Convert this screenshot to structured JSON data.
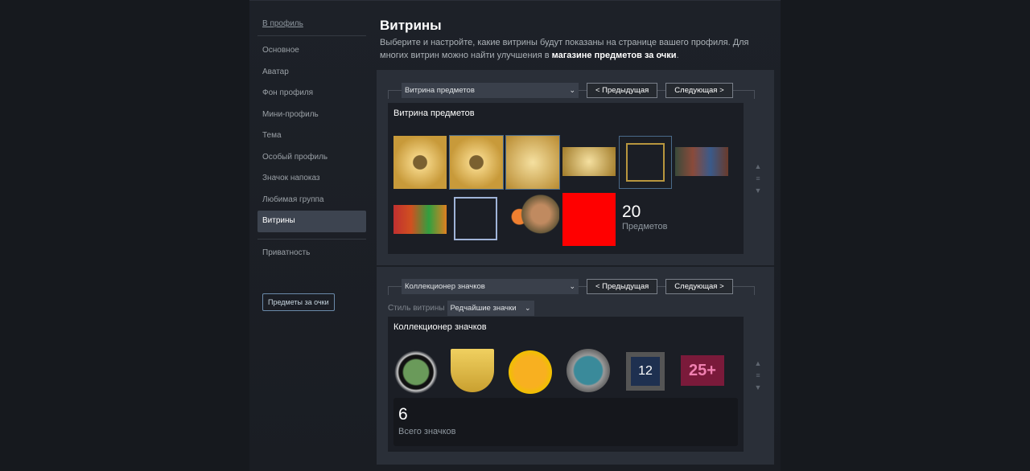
{
  "sidebar": {
    "back": "В профиль",
    "items": [
      "Основное",
      "Аватар",
      "Фон профиля",
      "Мини-профиль",
      "Тема",
      "Особый профиль",
      "Значок напоказ",
      "Любимая группа",
      "Витрины"
    ],
    "privacy": "Приватность",
    "points_button": "Предметы за очки"
  },
  "header": {
    "title": "Витрины",
    "desc_1": "Выберите и настройте, какие витрины будут показаны на странице вашего профиля. Для многих витрин можно найти улучшения в ",
    "desc_link": "магазине предметов за очки",
    "desc_end": "."
  },
  "showcase1": {
    "select": "Витрина предметов",
    "prev": "< Предыдущая",
    "next": "Следующая >",
    "title": "Витрина предметов",
    "count": "20",
    "count_label": "Предметов"
  },
  "showcase2": {
    "select": "Коллекционер значков",
    "prev": "< Предыдущая",
    "next": "Следующая >",
    "style_label": "Стиль витрины",
    "style_value": "Редчайшие значки",
    "title": "Коллекционер значков",
    "badge_25": "25+",
    "badge_12": "12",
    "count": "6",
    "count_label": "Всего значков"
  },
  "icons": {
    "chevron": "⌄",
    "up": "▲",
    "handle": "≡",
    "down": "▼"
  }
}
